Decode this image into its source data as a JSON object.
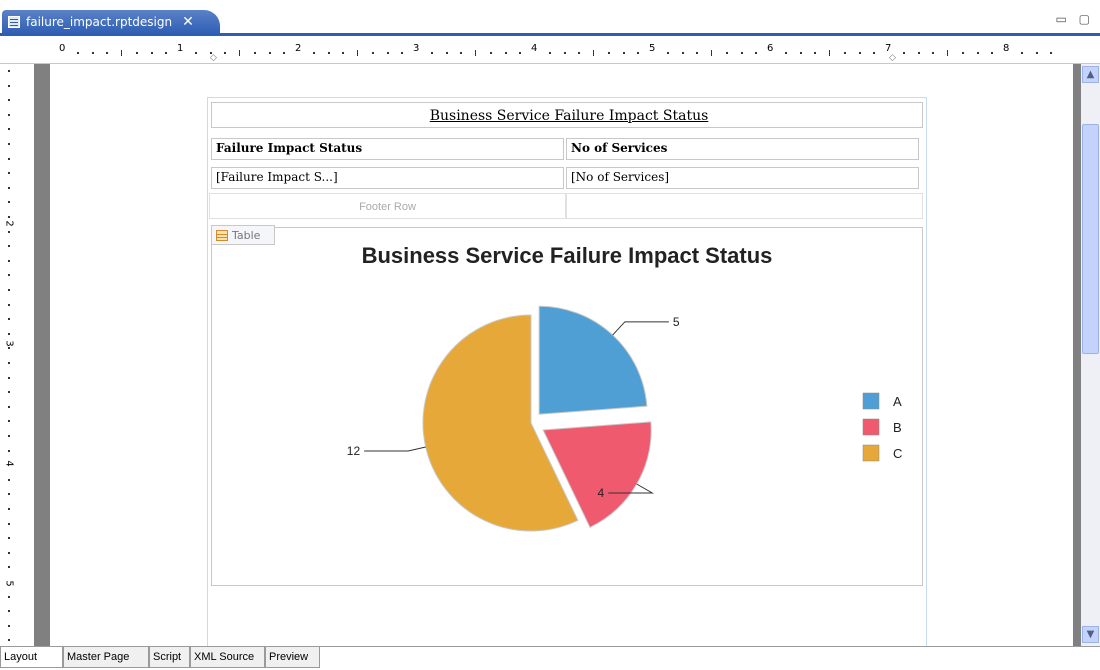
{
  "editor": {
    "tab_title": "failure_impact.rptdesign",
    "close_glyph": "✕",
    "window_controls": "▭ ▢"
  },
  "ruler": {
    "h_numbers": [
      "0",
      "1",
      "2",
      "3",
      "4",
      "5",
      "6",
      "7",
      "8"
    ],
    "v_numbers": [
      "2",
      "3",
      "4",
      "5"
    ]
  },
  "report": {
    "title": "Business Service Failure Impact Status",
    "header_col1": "Failure Impact Status",
    "header_col2": "No of Services",
    "detail_col1": "[Failure Impact S...]",
    "detail_col2": "[No of Services]",
    "footer_label": "Footer Row",
    "table_tag": "Table"
  },
  "chart_data": {
    "type": "pie",
    "title": "Business Service Failure Impact Status",
    "categories": [
      "A",
      "B",
      "C"
    ],
    "values": [
      5,
      4,
      12
    ],
    "colors": [
      "#4f9fd4",
      "#f05a6e",
      "#e7a83a"
    ],
    "legend": "right",
    "exploded": true,
    "data_labels": [
      "5",
      "4",
      "12"
    ]
  },
  "bottom_tabs": [
    "Layout",
    "Master Page",
    "Script",
    "XML Source",
    "Preview"
  ],
  "active_tab": "Layout"
}
